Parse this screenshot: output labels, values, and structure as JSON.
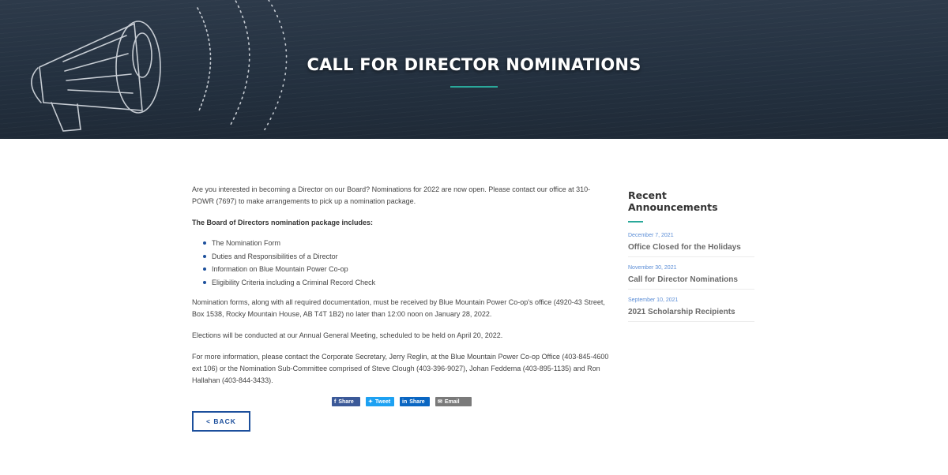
{
  "hero": {
    "title": "CALL FOR DIRECTOR NOMINATIONS",
    "accent_color": "#2aa89a",
    "background_icon": "megaphone-illustration"
  },
  "content": {
    "intro": "Are you interested in becoming a Director on our Board? Nominations for 2022 are now open. Please contact our office at 310-POWR (7697) to make arrangements to pick up a nomination package.",
    "package_heading": "The Board of Directors nomination package includes:",
    "package_items": [
      "The Nomination Form",
      "Duties and Responsibilities of a Director",
      "Information on Blue Mountain Power Co-op",
      "Eligibility Criteria including a Criminal Record Check"
    ],
    "deadline": "Nomination forms, along with all required documentation, must be received by Blue Mountain Power Co-op's office (4920-43 Street, Box 1538, Rocky Mountain House, AB T4T 1B2) no later than 12:00 noon on January 28, 2022.",
    "elections": "Elections will be conducted at our Annual General Meeting, scheduled to be held on April 20, 2022.",
    "more_info": "For more information, please contact the Corporate Secretary, Jerry Reglin, at the Blue Mountain Power Co-op Office (403-845-4600 ext 106) or the Nomination Sub-Committee comprised of Steve Clough (403-396-9027), Johan Feddema (403-895-1135) and Ron Hallahan (403-844-3433)."
  },
  "share": {
    "facebook": "Share",
    "twitter": "Tweet",
    "linkedin": "Share",
    "email": "Email"
  },
  "back_label": "< BACK",
  "sidebar": {
    "heading": "Recent Announcements",
    "announcements": [
      {
        "date": "December 7, 2021",
        "title": "Office Closed for the Holidays"
      },
      {
        "date": "November 30, 2021",
        "title": "Call for Director Nominations"
      },
      {
        "date": "September 10, 2021",
        "title": "2021 Scholarship Recipients"
      }
    ]
  },
  "colors": {
    "brand_blue": "#1c4f9c",
    "date_blue": "#5b8dd6",
    "facebook": "#3b5998",
    "twitter": "#1da1f2",
    "linkedin": "#0a66c2",
    "email": "#7a7a7a"
  }
}
